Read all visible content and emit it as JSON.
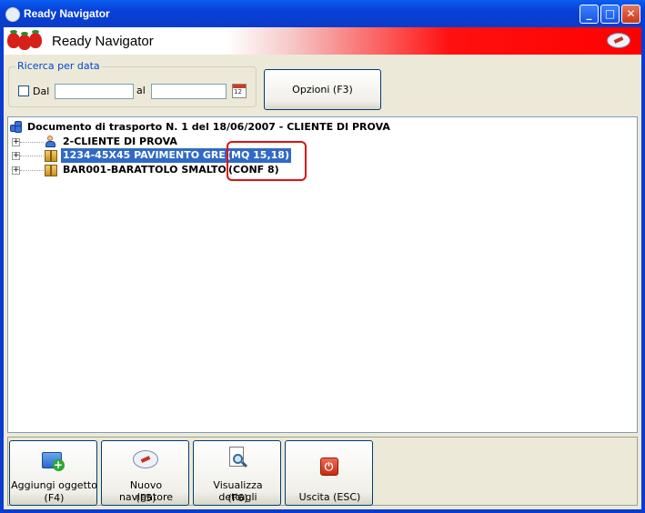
{
  "window": {
    "title": "Ready Navigator"
  },
  "header": {
    "title": "Ready Navigator"
  },
  "filter": {
    "legend": "Ricerca per data",
    "from_label": "Dal",
    "to_label": "al",
    "from_value": "",
    "to_value": "",
    "calendar_text": "12",
    "options_button": "Opzioni (F3)"
  },
  "tree": {
    "root": "Documento di trasporto N. 1 del 18/06/2007 - CLIENTE DI PROVA",
    "items": [
      {
        "label": "2-CLIENTE DI PROVA",
        "icon": "person-icon"
      },
      {
        "label": "1234-45X45 PAVIMENTO GRES",
        "qty": "(MQ 15,18)",
        "icon": "box-icon",
        "selected": true
      },
      {
        "label": "BAR001-BARATTOLO SMALTO",
        "qty": "(CONF 8)",
        "icon": "box-icon"
      }
    ]
  },
  "toolbar": {
    "buttons": [
      {
        "line1": "Aggiungi oggetto",
        "line2": "(F4)"
      },
      {
        "line1": "Nuovo navigatore",
        "line2": "(F5)"
      },
      {
        "line1": "Visualizza dettagli",
        "line2": "(F6)"
      },
      {
        "line1": "Uscita (ESC)",
        "line2": ""
      }
    ]
  },
  "colors": {
    "selection": "#316ac5",
    "highlight_box": "#e01010",
    "title_bar": "#0a4ee0"
  }
}
